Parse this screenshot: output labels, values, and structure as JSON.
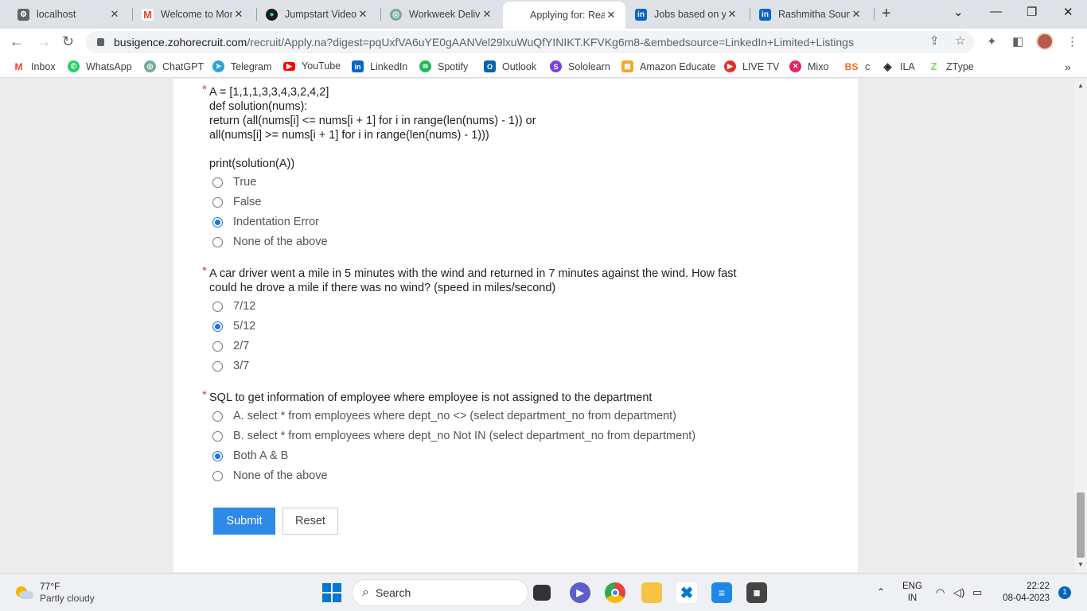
{
  "tabs": [
    {
      "title": "localhost",
      "icon": "settings-icon",
      "color": "#5f6368"
    },
    {
      "title": "Welcome to Mon",
      "icon": "gmail-icon",
      "color": "#ea4335"
    },
    {
      "title": "Jumpstart Video",
      "icon": "jumpstart-icon",
      "color": "#1b1b1b"
    },
    {
      "title": "Workweek Delive",
      "icon": "chatgpt-icon",
      "color": "#74aa9c"
    },
    {
      "title": "Applying for: Rea",
      "icon": "zoho-icon",
      "color": "#ffffff"
    },
    {
      "title": "Jobs based on yo",
      "icon": "linkedin-icon",
      "color": "#0a66c2"
    },
    {
      "title": "Rashmitha Soum",
      "icon": "linkedin-icon",
      "color": "#0a66c2"
    }
  ],
  "address_bar": {
    "host": "busigence.zohorecruit.com",
    "path": "/recruit/Apply.na?digest=pqUxfVA6uYE0gAANVel29lxuWuQfYINIKT.KFVKg6m8-&embedsource=LinkedIn+Limited+Listings"
  },
  "bookmarks": [
    {
      "label": "Inbox",
      "icon": "gmail-icon",
      "color": "#ea4335"
    },
    {
      "label": "WhatsApp",
      "icon": "whatsapp-icon",
      "color": "#25d366"
    },
    {
      "label": "ChatGPT",
      "icon": "chatgpt-icon",
      "color": "#74aa9c"
    },
    {
      "label": "Telegram",
      "icon": "telegram-icon",
      "color": "#2aa3df"
    },
    {
      "label": "YouTube",
      "icon": "youtube-icon",
      "color": "#ff0000"
    },
    {
      "label": "LinkedIn",
      "icon": "linkedin-icon",
      "color": "#0a66c2"
    },
    {
      "label": "Spotify",
      "icon": "spotify-icon",
      "color": "#1db954"
    },
    {
      "label": "Outlook",
      "icon": "outlook-icon",
      "color": "#0a64ad"
    },
    {
      "label": "Sololearn",
      "icon": "sololearn-icon",
      "color": "#7b3fe4"
    },
    {
      "label": "Amazon Educate",
      "icon": "amazon-icon",
      "color": "#f5a623"
    },
    {
      "label": "LIVE TV",
      "icon": "livetv-icon",
      "color": "#e52d27"
    },
    {
      "label": "Mixo",
      "icon": "mixo-icon",
      "color": "#e8225d"
    },
    {
      "label": "c",
      "icon": "bs-icon",
      "color": "#f26a21"
    },
    {
      "label": "ILA",
      "icon": "ila-icon",
      "color": "#222222"
    },
    {
      "label": "ZType",
      "icon": "ztype-icon",
      "color": "#7ed957"
    }
  ],
  "questions": [
    {
      "code_lines": [
        "A = [1,1,1,3,3,4,3,2,4,2]",
        "def solution(nums):",
        "return (all(nums[i] <= nums[i + 1] for i in range(len(nums) - 1)) or",
        "all(nums[i] >= nums[i + 1] for i in range(len(nums) - 1)))",
        "",
        "print(solution(A))"
      ],
      "options": [
        "True",
        "False",
        "Indentation Error",
        "None of the above"
      ],
      "selected": 2
    },
    {
      "text_lines": [
        "A car driver went a mile in 5 minutes with the wind and returned in 7 minutes against the wind. How fast",
        "could he drove a mile if there was no wind? (speed in miles/second)"
      ],
      "options": [
        "7/12",
        "5/12",
        "2/7",
        "3/7"
      ],
      "selected": 1
    },
    {
      "text_lines": [
        "SQL to get information of employee where employee is not assigned to the department"
      ],
      "options": [
        "A. select * from employees where dept_no <> (select department_no from department)",
        "B. select * from employees where dept_no Not IN (select department_no from department)",
        "Both A & B",
        "None of the above"
      ],
      "selected": 2
    }
  ],
  "required_mark": "*",
  "buttons": {
    "submit": "Submit",
    "reset": "Reset"
  },
  "taskbar": {
    "weather_temp": "77°F",
    "weather_desc": "Partly cloudy",
    "search_label": "Search",
    "lang_top": "ENG",
    "lang_bottom": "IN",
    "time": "22:22",
    "date": "08-04-2023",
    "notification_count": "1"
  },
  "colors": {
    "accent": "#2e8ae6",
    "radio_selected": "#1a73e8",
    "required": "#e53935"
  }
}
